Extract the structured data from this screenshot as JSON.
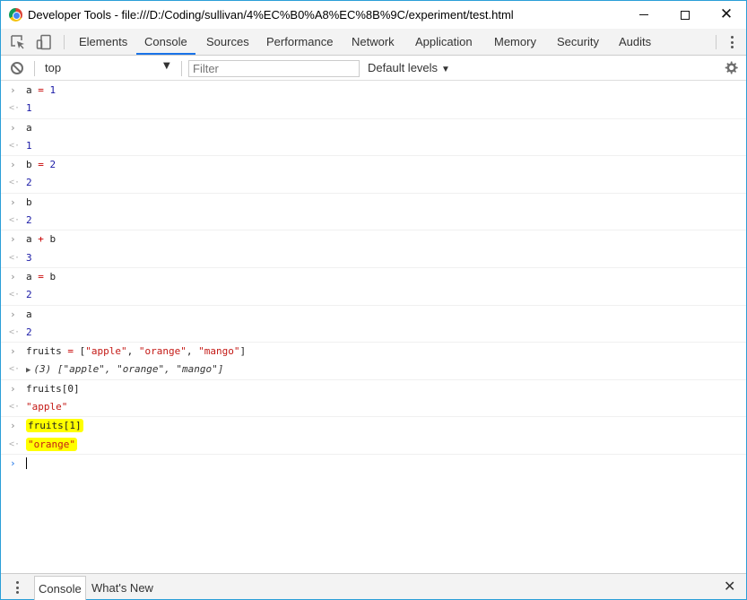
{
  "window": {
    "title": "Developer Tools - file:///D:/Coding/sullivan/4%EC%B0%A8%EC%8B%9C/experiment/test.html",
    "min_icon": "minimize-icon",
    "max_icon": "maximize-icon",
    "close_icon": "close-icon"
  },
  "tabbar": {
    "icons": [
      "inspect-element-icon",
      "device-toolbar-icon"
    ],
    "tabs": [
      "Elements",
      "Console",
      "Sources",
      "Performance",
      "Network",
      "Application",
      "Memory",
      "Security",
      "Audits"
    ],
    "active_tab": "Console",
    "accent_color": "#1a73e8"
  },
  "toolbar": {
    "context": "top",
    "filter_placeholder": "Filter",
    "levels_label": "Default levels"
  },
  "console": {
    "entries": [
      {
        "input": [
          {
            "t": "a",
            "c": "plain"
          },
          {
            "t": " = ",
            "c": "op"
          },
          {
            "t": "1",
            "c": "num"
          }
        ],
        "output": [
          {
            "t": "1",
            "c": "num"
          }
        ]
      },
      {
        "input": [
          {
            "t": "a",
            "c": "plain"
          }
        ],
        "output": [
          {
            "t": "1",
            "c": "num"
          }
        ]
      },
      {
        "input": [
          {
            "t": "b",
            "c": "plain"
          },
          {
            "t": " = ",
            "c": "op"
          },
          {
            "t": "2",
            "c": "num"
          }
        ],
        "output": [
          {
            "t": "2",
            "c": "num"
          }
        ]
      },
      {
        "input": [
          {
            "t": "b",
            "c": "plain"
          }
        ],
        "output": [
          {
            "t": "2",
            "c": "num"
          }
        ]
      },
      {
        "input": [
          {
            "t": "a",
            "c": "plain"
          },
          {
            "t": " + ",
            "c": "op"
          },
          {
            "t": "b",
            "c": "plain"
          }
        ],
        "output": [
          {
            "t": "3",
            "c": "num"
          }
        ]
      },
      {
        "input": [
          {
            "t": "a",
            "c": "plain"
          },
          {
            "t": " = ",
            "c": "op"
          },
          {
            "t": "b",
            "c": "plain"
          }
        ],
        "output": [
          {
            "t": "2",
            "c": "num"
          }
        ]
      },
      {
        "input": [
          {
            "t": "a",
            "c": "plain"
          }
        ],
        "output": [
          {
            "t": "2",
            "c": "num"
          }
        ]
      },
      {
        "input": [
          {
            "t": "fruits",
            "c": "plain"
          },
          {
            "t": " = ",
            "c": "op"
          },
          {
            "t": "[",
            "c": "plain"
          },
          {
            "t": "\"apple\"",
            "c": "str"
          },
          {
            "t": ", ",
            "c": "plain"
          },
          {
            "t": "\"orange\"",
            "c": "str"
          },
          {
            "t": ", ",
            "c": "plain"
          },
          {
            "t": "\"mango\"",
            "c": "str"
          },
          {
            "t": "]",
            "c": "plain"
          }
        ],
        "output": [
          {
            "t": "▶",
            "c": "arrow-tri"
          },
          {
            "t": "(3) [",
            "c": "italic"
          },
          {
            "t": "\"apple\"",
            "c": "str italic"
          },
          {
            "t": ", ",
            "c": "italic"
          },
          {
            "t": "\"orange\"",
            "c": "str italic"
          },
          {
            "t": ", ",
            "c": "italic"
          },
          {
            "t": "\"mango\"",
            "c": "str italic"
          },
          {
            "t": "]",
            "c": "italic"
          }
        ]
      },
      {
        "input": [
          {
            "t": "fruits[0]",
            "c": "plain"
          }
        ],
        "output": [
          {
            "t": "\"apple\"",
            "c": "str"
          }
        ]
      },
      {
        "input": [
          {
            "t": "fruits[1]",
            "c": "plain hl"
          }
        ],
        "output": [
          {
            "t": "\"orange\"",
            "c": "str hl"
          }
        ],
        "highlighted": true
      }
    ],
    "highlight_color": "#ffff00"
  },
  "drawer": {
    "tabs": [
      "Console",
      "What's New"
    ],
    "active_tab": "Console"
  }
}
